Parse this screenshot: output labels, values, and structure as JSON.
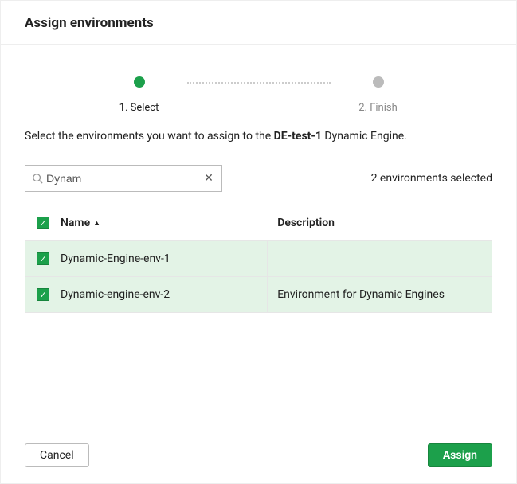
{
  "header": {
    "title": "Assign environments"
  },
  "stepper": {
    "step1_label": "1. Select",
    "step2_label": "2. Finish"
  },
  "instruction": {
    "prefix": "Select the environments you want to assign to the ",
    "engine_name": "DE-test-1",
    "suffix": " Dynamic Engine."
  },
  "search": {
    "value": "Dynam"
  },
  "selected_text": "2 environments selected",
  "columns": {
    "name": "Name",
    "description": "Description"
  },
  "rows": [
    {
      "name": "Dynamic-Engine-env-1",
      "description": ""
    },
    {
      "name": "Dynamic-engine-env-2",
      "description": "Environment for Dynamic Engines"
    }
  ],
  "footer": {
    "cancel": "Cancel",
    "assign": "Assign"
  }
}
